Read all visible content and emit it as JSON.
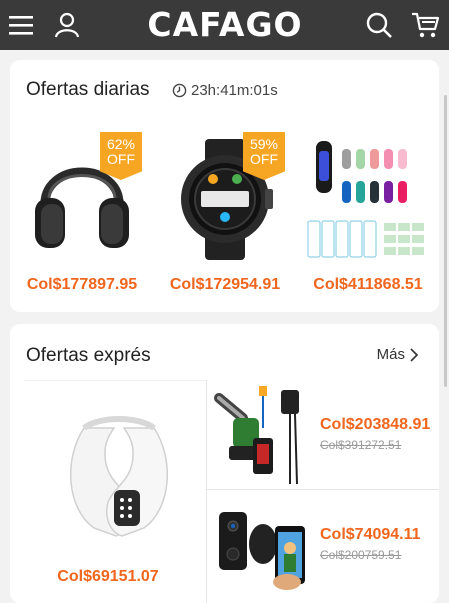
{
  "header": {
    "logo": "CAFAGO",
    "icons": [
      "menu-icon",
      "user-icon",
      "search-icon",
      "cart-icon"
    ],
    "bg": "#3a3a3a"
  },
  "daily": {
    "title": "Ofertas diarias",
    "timer": "23h:41m:01s",
    "items": [
      {
        "name": "headphones",
        "badge_pct": "62%",
        "badge_off": "OFF",
        "price": "Col$177897.95"
      },
      {
        "name": "smartwatch",
        "badge_pct": "59%",
        "badge_off": "OFF",
        "price": "Col$172954.91"
      },
      {
        "name": "fitness-band-straps",
        "price": "Col$411868.51"
      }
    ]
  },
  "express": {
    "title": "Ofertas exprés",
    "more": "Más",
    "main_item": {
      "name": "neck-massager",
      "price": "Col$69151.07"
    },
    "items": [
      {
        "name": "mini-chainsaw",
        "price": "Col$203848.91",
        "old_price": "Col$391272.51"
      },
      {
        "name": "video-doorbell",
        "price": "Col$74094.11",
        "old_price": "Col$200759.51"
      }
    ]
  },
  "colors": {
    "accent": "#f0661e",
    "badge": "#f7a623",
    "header": "#3a3a3a"
  }
}
